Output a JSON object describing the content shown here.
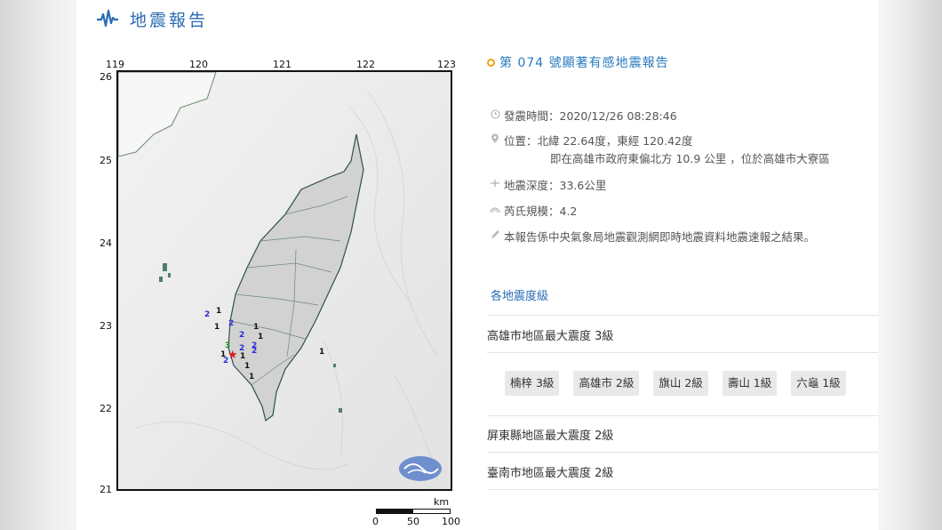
{
  "header": {
    "title": "地震報告",
    "icon": "seismograph-icon",
    "accent_color": "#2a6cb3"
  },
  "map": {
    "top_ticks": [
      "119",
      "120",
      "121",
      "122",
      "123"
    ],
    "left_ticks": [
      "26",
      "25",
      "24",
      "23",
      "22",
      "21"
    ],
    "scale": {
      "unit": "km",
      "labels": [
        "0",
        "50",
        "100"
      ]
    },
    "epicenter": "epicenter-star-icon",
    "intensity_markers": [
      "2",
      "1",
      "1",
      "2",
      "1",
      "2",
      "1",
      "3",
      "2",
      "2",
      "2",
      "1",
      "2",
      "1",
      "1",
      "1",
      "1"
    ],
    "logo": "cwb-logo-icon"
  },
  "report": {
    "title": "第 074 號顯著有感地震報告",
    "time": "發震時間：2020/12/26 08:28:46",
    "location": "位置：北緯 22.64度，東經 120.42度",
    "location_sub": "即在高雄市政府東偏北方 10.9 公里 ，位於高雄市大寮區",
    "depth": "地震深度：33.6公里",
    "magnitude": "芮氏規模：4.2",
    "note": "本報告係中央氣象局地震觀測網即時地震資料地震速報之結果。"
  },
  "intensity": {
    "section_label": "各地震度級",
    "regions": [
      {
        "label": "高雄市地區最大震度 3級"
      },
      {
        "label": "屏東縣地區最大震度 2級"
      },
      {
        "label": "臺南市地區最大震度 2級"
      }
    ],
    "stations": [
      "楠梓 3級",
      "高雄市 2級",
      "旗山 2級",
      "壽山 1級",
      "六龜 1級"
    ]
  }
}
